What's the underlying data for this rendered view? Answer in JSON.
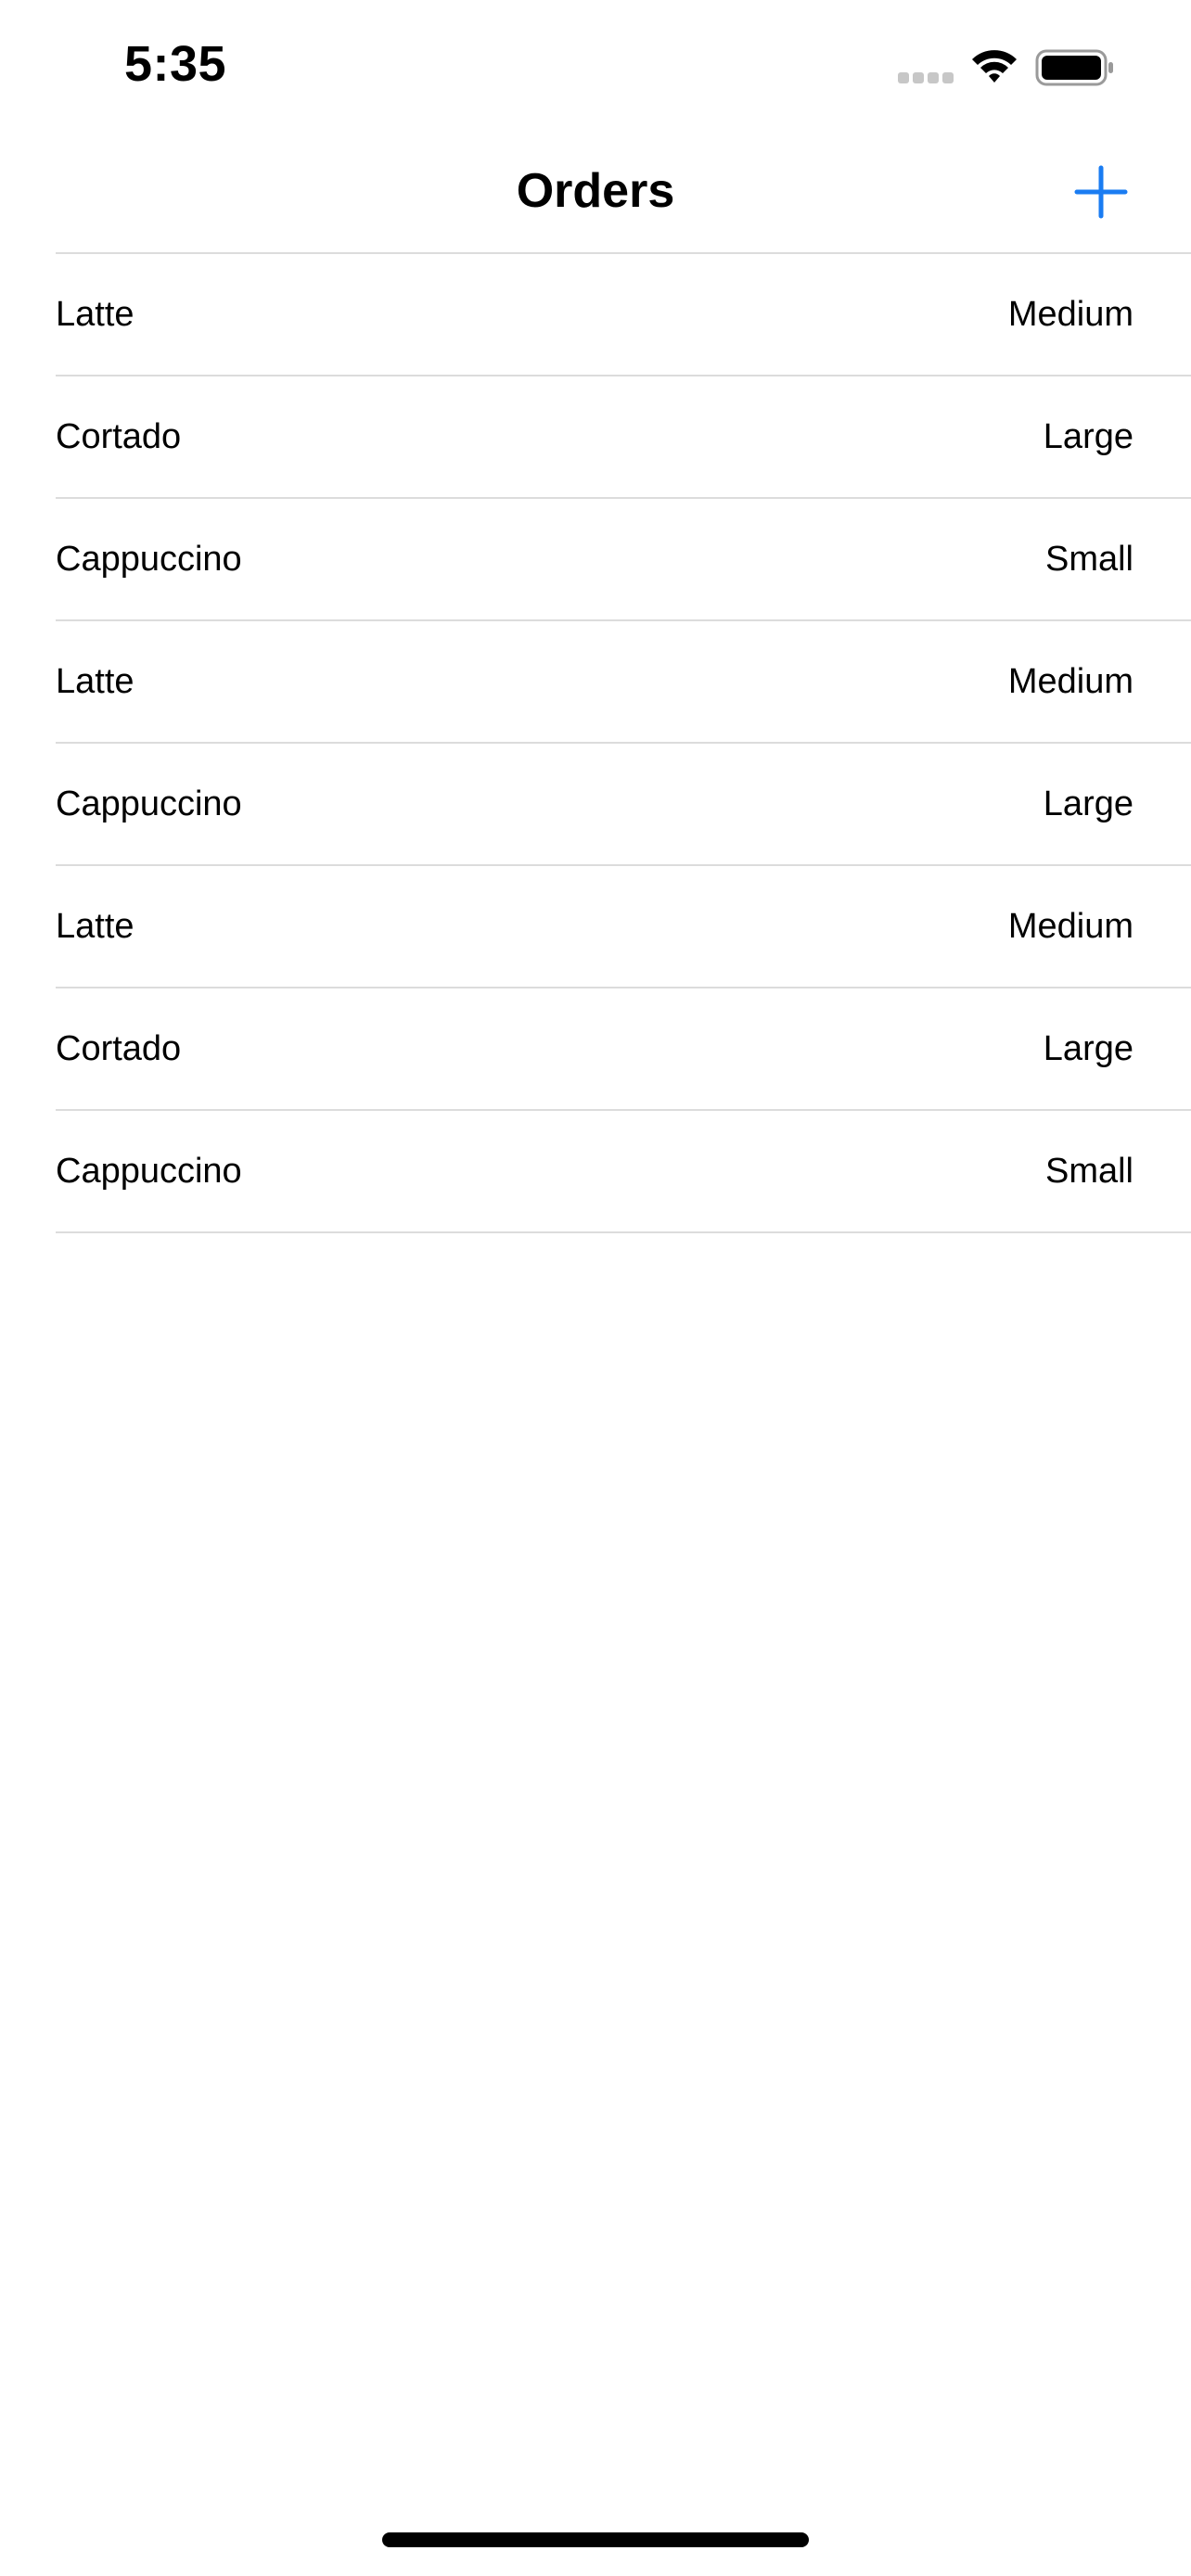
{
  "status_bar": {
    "time": "5:35",
    "icons": [
      "cellular-signal-icon",
      "wifi-icon",
      "battery-icon"
    ]
  },
  "nav": {
    "title": "Orders",
    "add_icon": "plus-icon",
    "accent_color": "#1a7cf2"
  },
  "orders": [
    {
      "name": "Latte",
      "size": "Medium"
    },
    {
      "name": "Cortado",
      "size": "Large"
    },
    {
      "name": "Cappuccino",
      "size": "Small"
    },
    {
      "name": "Latte",
      "size": "Medium"
    },
    {
      "name": "Cappuccino",
      "size": "Large"
    },
    {
      "name": "Latte",
      "size": "Medium"
    },
    {
      "name": "Cortado",
      "size": "Large"
    },
    {
      "name": "Cappuccino",
      "size": "Small"
    }
  ]
}
